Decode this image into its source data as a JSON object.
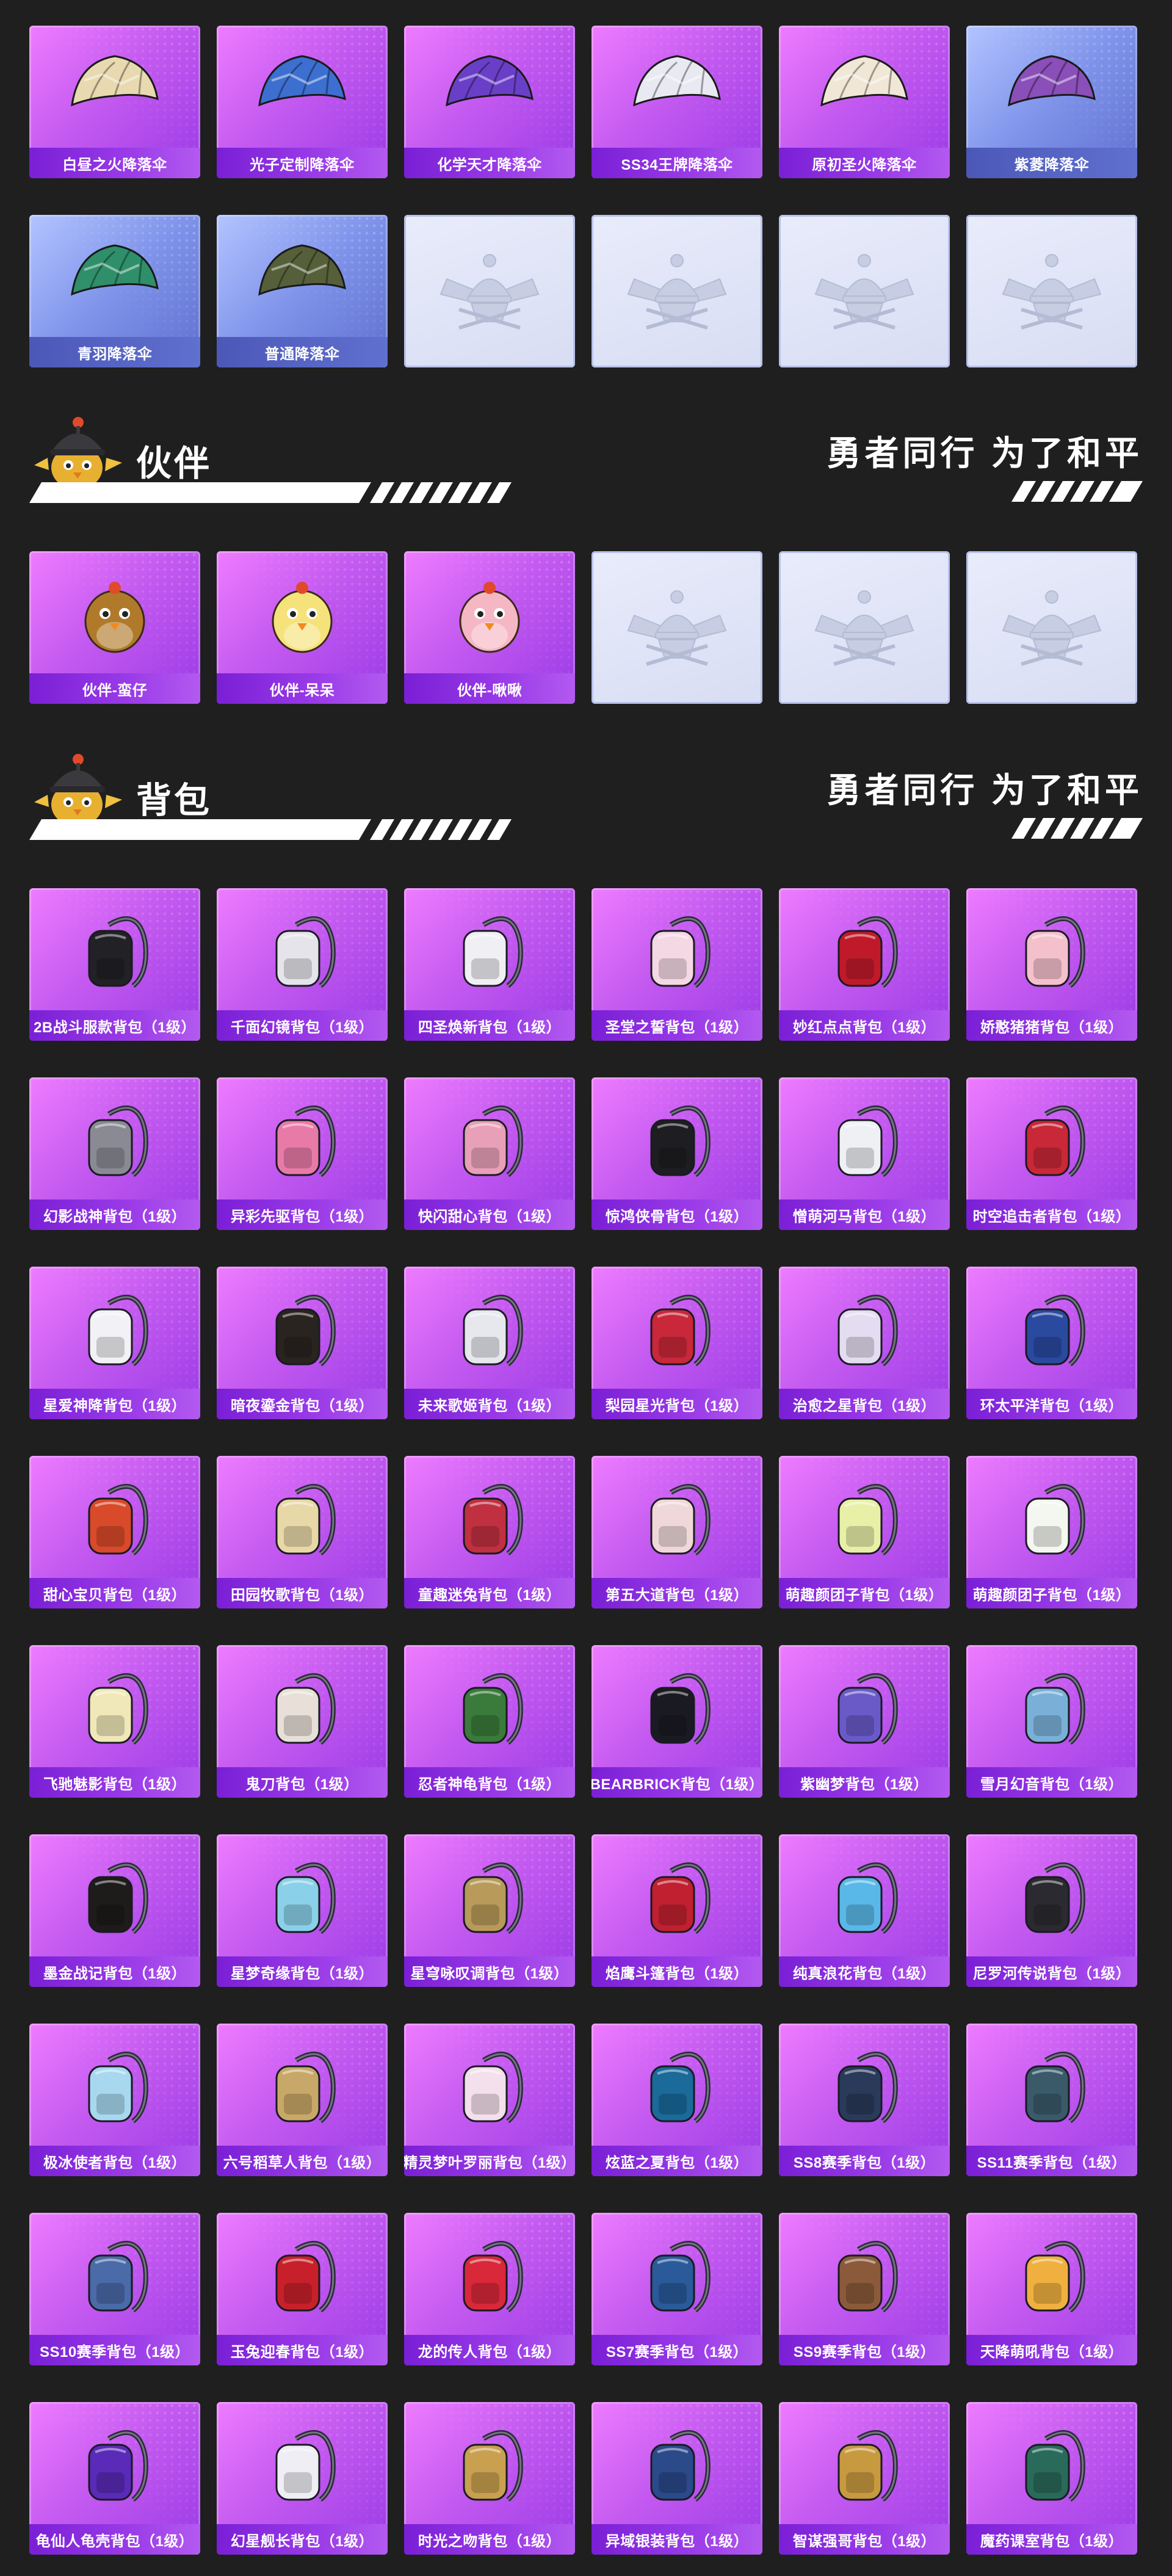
{
  "parachutes": [
    {
      "label": "白昼之火降落伞",
      "variant": "purple",
      "color": "#e8d9b0"
    },
    {
      "label": "光子定制降落伞",
      "variant": "purple",
      "color": "#3d6fd0"
    },
    {
      "label": "化学天才降落伞",
      "variant": "purple",
      "color": "#6a3fc8"
    },
    {
      "label": "SS34王牌降落伞",
      "variant": "purple",
      "color": "#e9e9f2"
    },
    {
      "label": "原初圣火降落伞",
      "variant": "purple",
      "color": "#f1e7d7"
    },
    {
      "label": "紫菱降落伞",
      "variant": "blue",
      "color": "#8a4fb8"
    },
    {
      "label": "青羽降落伞",
      "variant": "blue",
      "color": "#2f8f6a"
    },
    {
      "label": "普通降落伞",
      "variant": "blue",
      "color": "#55603a"
    },
    {
      "label": "",
      "variant": "empty"
    },
    {
      "label": "",
      "variant": "empty"
    },
    {
      "label": "",
      "variant": "empty"
    },
    {
      "label": "",
      "variant": "empty"
    }
  ],
  "companion_section": {
    "title": "伙伴",
    "slogan": "勇者同行 为了和平",
    "mascot_icon": "chicken-helmet-mascot-icon"
  },
  "companions": [
    {
      "label": "伙伴-蛮仔",
      "variant": "purple",
      "color": "#b07a2a"
    },
    {
      "label": "伙伴-呆呆",
      "variant": "purple",
      "color": "#f5e27a"
    },
    {
      "label": "伙伴-啾啾",
      "variant": "purple",
      "color": "#f6b7c4"
    },
    {
      "label": "",
      "variant": "empty"
    },
    {
      "label": "",
      "variant": "empty"
    },
    {
      "label": "",
      "variant": "empty"
    }
  ],
  "backpack_section": {
    "title": "背包",
    "slogan": "勇者同行 为了和平",
    "mascot_icon": "chicken-helmet-mascot-icon"
  },
  "backpacks": [
    {
      "label": "2B战斗服款背包（1级）",
      "color": "#222226"
    },
    {
      "label": "千面幻镜背包（1级）",
      "color": "#e4e4ea"
    },
    {
      "label": "四圣焕新背包（1级）",
      "color": "#f0f0f4"
    },
    {
      "label": "圣堂之誓背包（1级）",
      "color": "#f4d8e4"
    },
    {
      "label": "妙红点点背包（1级）",
      "color": "#c01a2a"
    },
    {
      "label": "娇憨猪猪背包（1级）",
      "color": "#f4c0cc"
    },
    {
      "label": "幻影战神背包（1级）",
      "color": "#8a8a94"
    },
    {
      "label": "异彩先驱背包（1级）",
      "color": "#e87aa8"
    },
    {
      "label": "快闪甜心背包（1级）",
      "color": "#e8a0b8"
    },
    {
      "label": "惊鸿侠骨背包（1级）",
      "color": "#1e1e22"
    },
    {
      "label": "憎萌河马背包（1级）",
      "color": "#eef0f4"
    },
    {
      "label": "时空追击者背包（1级）",
      "color": "#c82838"
    },
    {
      "label": "星爱神降背包（1级）",
      "color": "#f2f2f6"
    },
    {
      "label": "暗夜鎏金背包（1级）",
      "color": "#2a2420"
    },
    {
      "label": "未来歌姬背包（1级）",
      "color": "#e6e8ee"
    },
    {
      "label": "梨园星光背包（1级）",
      "color": "#c8283a"
    },
    {
      "label": "治愈之星背包（1级）",
      "color": "#e4dcf0"
    },
    {
      "label": "环太平洋背包（1级）",
      "color": "#2a4aa0"
    },
    {
      "label": "甜心宝贝背包（1级）",
      "color": "#d84a2a"
    },
    {
      "label": "田园牧歌背包（1级）",
      "color": "#e8d8a8"
    },
    {
      "label": "童趣迷兔背包（1级）",
      "color": "#c03040"
    },
    {
      "label": "第五大道背包（1级）",
      "color": "#f0d8d8"
    },
    {
      "label": "萌趣颜团子背包（1级）",
      "color": "#e8f0a8"
    },
    {
      "label": "萌趣颜团子背包（1级）",
      "color": "#f4f6f0"
    },
    {
      "label": "飞驰魅影背包（1级）",
      "color": "#f0e8b8"
    },
    {
      "label": "鬼刀背包（1级）",
      "color": "#e8e0d8"
    },
    {
      "label": "忍者神龟背包（1级）",
      "color": "#3a7a3a"
    },
    {
      "label": "BEARBRICK背包（1级）",
      "color": "#1a1a22"
    },
    {
      "label": "紫幽梦背包（1级）",
      "color": "#6a5ac8"
    },
    {
      "label": "雪月幻音背包（1级）",
      "color": "#7ab0d8"
    },
    {
      "label": "墨金战记背包（1级）",
      "color": "#1e1c1a"
    },
    {
      "label": "星梦奇缘背包（1级）",
      "color": "#8ad0e8"
    },
    {
      "label": "星穹咏叹调背包（1级）",
      "color": "#b89a5a"
    },
    {
      "label": "焰鹰斗篷背包（1级）",
      "color": "#c02030"
    },
    {
      "label": "纯真浪花背包（1级）",
      "color": "#5ab8e8"
    },
    {
      "label": "尼罗河传说背包（1级）",
      "color": "#2a2a30"
    },
    {
      "label": "极冰使者背包（1级）",
      "color": "#a8d8f0"
    },
    {
      "label": "六号稻草人背包（1级）",
      "color": "#c8a868"
    },
    {
      "label": "精灵梦叶罗丽背包（1级）",
      "color": "#f4e0ec"
    },
    {
      "label": "炫蓝之夏背包（1级）",
      "color": "#1a6a9a"
    },
    {
      "label": "SS8赛季背包（1级）",
      "color": "#2a3a5a"
    },
    {
      "label": "SS11赛季背包（1级）",
      "color": "#3a5a6a"
    },
    {
      "label": "SS10赛季背包（1级）",
      "color": "#4a6aa8"
    },
    {
      "label": "玉兔迎春背包（1级）",
      "color": "#c8202a"
    },
    {
      "label": "龙的传人背包（1级）",
      "color": "#d8283a"
    },
    {
      "label": "SS7赛季背包（1级）",
      "color": "#2a5a9a"
    },
    {
      "label": "SS9赛季背包（1级）",
      "color": "#8a5a3a"
    },
    {
      "label": "天降萌吼背包（1级）",
      "color": "#f0b040"
    },
    {
      "label": "龟仙人龟壳背包（1级）",
      "color": "#5a2ab8"
    },
    {
      "label": "幻星舰长背包（1级）",
      "color": "#eeeef4"
    },
    {
      "label": "时光之吻背包（1级）",
      "color": "#c8a050"
    },
    {
      "label": "异域银装背包（1级）",
      "color": "#2a4a8a"
    },
    {
      "label": "智谋强哥背包（1级）",
      "color": "#c89a40"
    },
    {
      "label": "魔药课室背包（1级）",
      "color": "#2a6a5a"
    }
  ]
}
